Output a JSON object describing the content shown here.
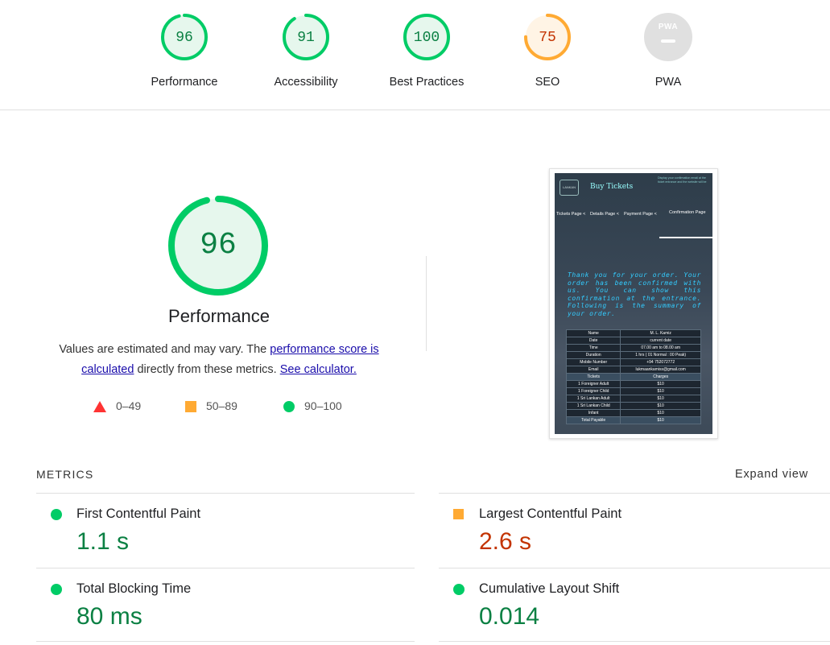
{
  "categories": [
    {
      "label": "Performance",
      "score": "96",
      "status": "pass",
      "fraction": 0.96
    },
    {
      "label": "Accessibility",
      "score": "91",
      "status": "pass",
      "fraction": 0.91
    },
    {
      "label": "Best Practices",
      "score": "100",
      "status": "pass",
      "fraction": 1.0
    },
    {
      "label": "SEO",
      "score": "75",
      "status": "average",
      "fraction": 0.75
    },
    {
      "label": "PWA",
      "score": "",
      "status": "na",
      "badge_text": "PWA"
    }
  ],
  "main": {
    "score": "96",
    "fraction": 0.96,
    "title": "Performance",
    "desc_prefix": "Values are estimated and may vary. The ",
    "desc_link1": "performance score is calculated",
    "desc_mid": " directly from these metrics. ",
    "desc_link2": "See calculator."
  },
  "legend": [
    {
      "range": "0–49",
      "shape": "triangle",
      "color": "#ff3333"
    },
    {
      "range": "50–89",
      "shape": "square",
      "color": "#ffaa33"
    },
    {
      "range": "90–100",
      "shape": "circle",
      "color": "#00cc66"
    }
  ],
  "thumbnail": {
    "header_title": "Buy Tickets",
    "logo_text": "LANKAN",
    "note": "Display your confirmation email at the ticket entrance and the website will be",
    "steps": [
      "Tickets Page <",
      "Details Page <",
      "Payment Page <",
      "Confirmation Page"
    ],
    "thanks": "Thank you for your order. Your order has been confirmed with us. You can show this confirmation at the entrance. Following is the summary of your order.",
    "rows": [
      [
        "Name",
        "M. L. Kamiz"
      ],
      [
        "Date",
        "current date"
      ],
      [
        "Time",
        "07.00 am to 08.00 am"
      ],
      [
        "Duration",
        "1 hrs ( 01 Normal : 00 Peak)"
      ],
      [
        "Mobile Number",
        "+94 752072772"
      ],
      [
        "Email",
        "lukmaankamiss@gmail.com"
      ],
      [
        "Tickets",
        "Charges"
      ],
      [
        "1 Foreigner Adult",
        "$10"
      ],
      [
        "1 Foreigner Child",
        "$10"
      ],
      [
        "1 Sri Lankan Adult",
        "$10"
      ],
      [
        "1 Sri Lankan Child",
        "$10"
      ],
      [
        "Infant",
        "$10"
      ],
      [
        "Total Payable",
        "$10"
      ]
    ]
  },
  "metrics": {
    "header": "METRICS",
    "expand_label": "Expand view",
    "items": [
      {
        "name": "First Contentful Paint",
        "value": "1.1 s",
        "status": "pass"
      },
      {
        "name": "Largest Contentful Paint",
        "value": "2.6 s",
        "status": "average"
      },
      {
        "name": "Total Blocking Time",
        "value": "80 ms",
        "status": "pass"
      },
      {
        "name": "Cumulative Layout Shift",
        "value": "0.014",
        "status": "pass"
      }
    ]
  },
  "colors": {
    "pass": "#0c6",
    "pass_text": "#0b8043",
    "average": "#fa3",
    "average_text": "#c33300",
    "fail": "#f33",
    "na": "#e0e0e0"
  }
}
